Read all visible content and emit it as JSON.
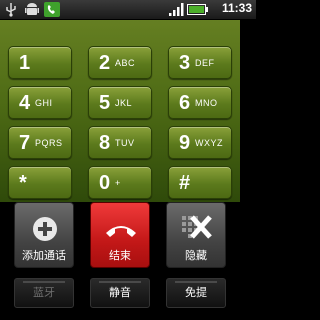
{
  "status_bar": {
    "time": "11:33",
    "icons": [
      "usb-icon",
      "android-debug-icon",
      "phone-call-icon",
      "signal-icon",
      "battery-icon"
    ]
  },
  "keypad": {
    "keys": [
      {
        "digit": "1",
        "letters": ""
      },
      {
        "digit": "2",
        "letters": "ABC"
      },
      {
        "digit": "3",
        "letters": "DEF"
      },
      {
        "digit": "4",
        "letters": "GHI"
      },
      {
        "digit": "5",
        "letters": "JKL"
      },
      {
        "digit": "6",
        "letters": "MNO"
      },
      {
        "digit": "7",
        "letters": "PQRS"
      },
      {
        "digit": "8",
        "letters": "TUV"
      },
      {
        "digit": "9",
        "letters": "WXYZ"
      },
      {
        "digit": "*",
        "letters": ""
      },
      {
        "digit": "0",
        "letters": "+"
      },
      {
        "digit": "#",
        "letters": ""
      }
    ]
  },
  "actions": {
    "add_call": "添加通话",
    "end": "结束",
    "hide": "隐藏"
  },
  "toggles": {
    "bluetooth": "蓝牙",
    "mute": "静音",
    "speaker": "免提"
  },
  "colors": {
    "keypad_bg": "#4e6b15",
    "end_button": "#d42020",
    "status_battery": "#4caf2a"
  }
}
